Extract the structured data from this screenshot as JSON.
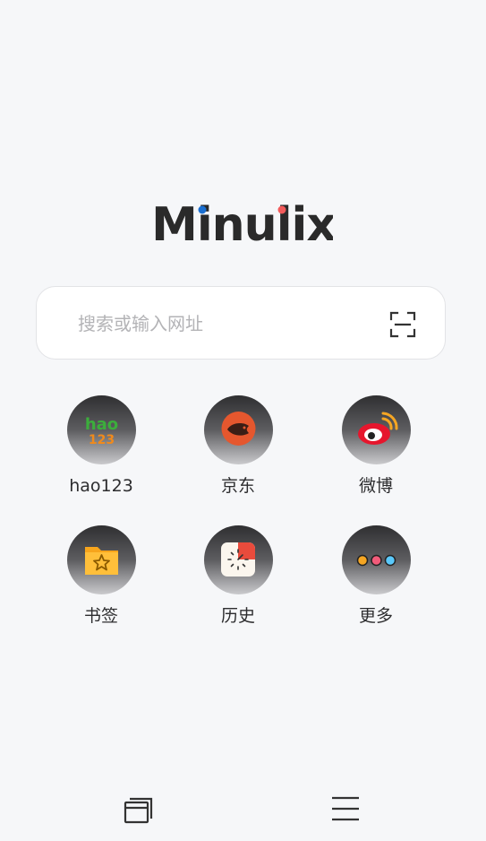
{
  "logo": {
    "text": "Minulix",
    "dot_colors": [
      "#1a6fd1",
      "#f25b5b"
    ]
  },
  "search": {
    "placeholder": "搜索或输入网址",
    "scan_icon": "scan-icon"
  },
  "shortcuts": [
    {
      "label": "hao123",
      "icon": "hao123-icon"
    },
    {
      "label": "京东",
      "icon": "jd-icon"
    },
    {
      "label": "微博",
      "icon": "weibo-icon"
    },
    {
      "label": "书签",
      "icon": "bookmark-folder-icon"
    },
    {
      "label": "历史",
      "icon": "history-clock-icon"
    },
    {
      "label": "更多",
      "icon": "more-dots-icon"
    }
  ],
  "bottom_bar": {
    "left_icon": "tabs-icon",
    "right_icon": "menu-icon"
  },
  "colors": {
    "background": "#f6f7f9",
    "text": "#2d2d2f",
    "placeholder": "#b3b3b6"
  }
}
